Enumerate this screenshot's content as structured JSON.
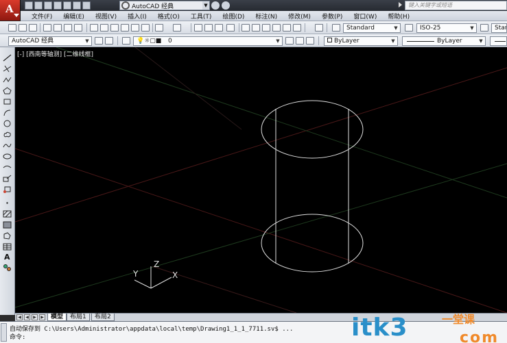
{
  "app": {
    "logo_letter": "A",
    "workspace": "AutoCAD 经典",
    "search_placeholder": "键入关键字或短语"
  },
  "menu": {
    "items": [
      "文件(F)",
      "编辑(E)",
      "视图(V)",
      "插入(I)",
      "格式(O)",
      "工具(T)",
      "绘图(D)",
      "标注(N)",
      "修改(M)",
      "参数(P)",
      "窗口(W)",
      "帮助(H)"
    ]
  },
  "styles_toolbar": {
    "text_style": "Standard",
    "dim_style": "ISO-25",
    "table_style": "Stand"
  },
  "layers_toolbar": {
    "workspace_combo": "AutoCAD 经典",
    "layer": "0",
    "color": "ByLayer",
    "linetype": "ByLayer"
  },
  "viewport": {
    "label": "[-] [西南等轴测] [二维线框]",
    "ucs_x": "X",
    "ucs_y": "Y",
    "ucs_z": "Z"
  },
  "left_tools": {
    "text_tool": "A"
  },
  "layout_tabs": {
    "model": "模型",
    "layout1": "布局1",
    "layout2": "布局2"
  },
  "command": {
    "history": "自动保存到 C:\\Users\\Administrator\\appdata\\local\\temp\\Drawing1_1_1_7711.sv$ ...",
    "prompt": "命令:"
  },
  "watermark": {
    "text": "itk3",
    "cn": "一堂课",
    "dots": "com"
  },
  "colors": {
    "canvas": "#000000",
    "grid_line": "#5a1e1e",
    "geometry": "#e0e0e0",
    "accent": "#2a8fc9",
    "watermark_orange": "#f08a2b"
  }
}
